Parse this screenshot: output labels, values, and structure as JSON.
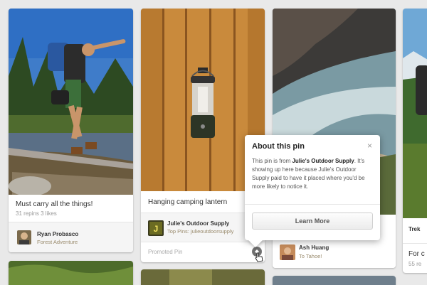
{
  "pins": [
    {
      "description": "Must carry all the things!",
      "stats": "31 repins  3 likes",
      "pinner": {
        "name": "Ryan Probasco",
        "board": "Forest Adventure"
      }
    },
    {
      "description": "Hanging camping lantern",
      "pinner": {
        "name": "Julie's Outdoor Supply",
        "board": "Top Pins: julieoutdoorsupply"
      },
      "promoted_label": "Promoted Pin"
    },
    {
      "pinner": {
        "name": "Ash Huang",
        "board": "To Tahoe!"
      }
    },
    {
      "header_partial": "Trek",
      "description_partial": "For c",
      "stats_partial": "55 re"
    }
  ],
  "popup": {
    "title": "About this pin",
    "close_glyph": "×",
    "body_prefix": "This pin is from ",
    "body_brand": "Julie's Outdoor Supply",
    "body_rest": ". It's showing up here because Julie's Outdoor Supply paid to have it placed where you'd be more likely to notice it.",
    "learn_more_label": "Learn More"
  },
  "icons": [
    "promoted-info-icon",
    "close-icon",
    "hand-cursor-icon"
  ],
  "colors": {
    "board_link": "#9a8b6d",
    "background": "#e9e9e9"
  }
}
